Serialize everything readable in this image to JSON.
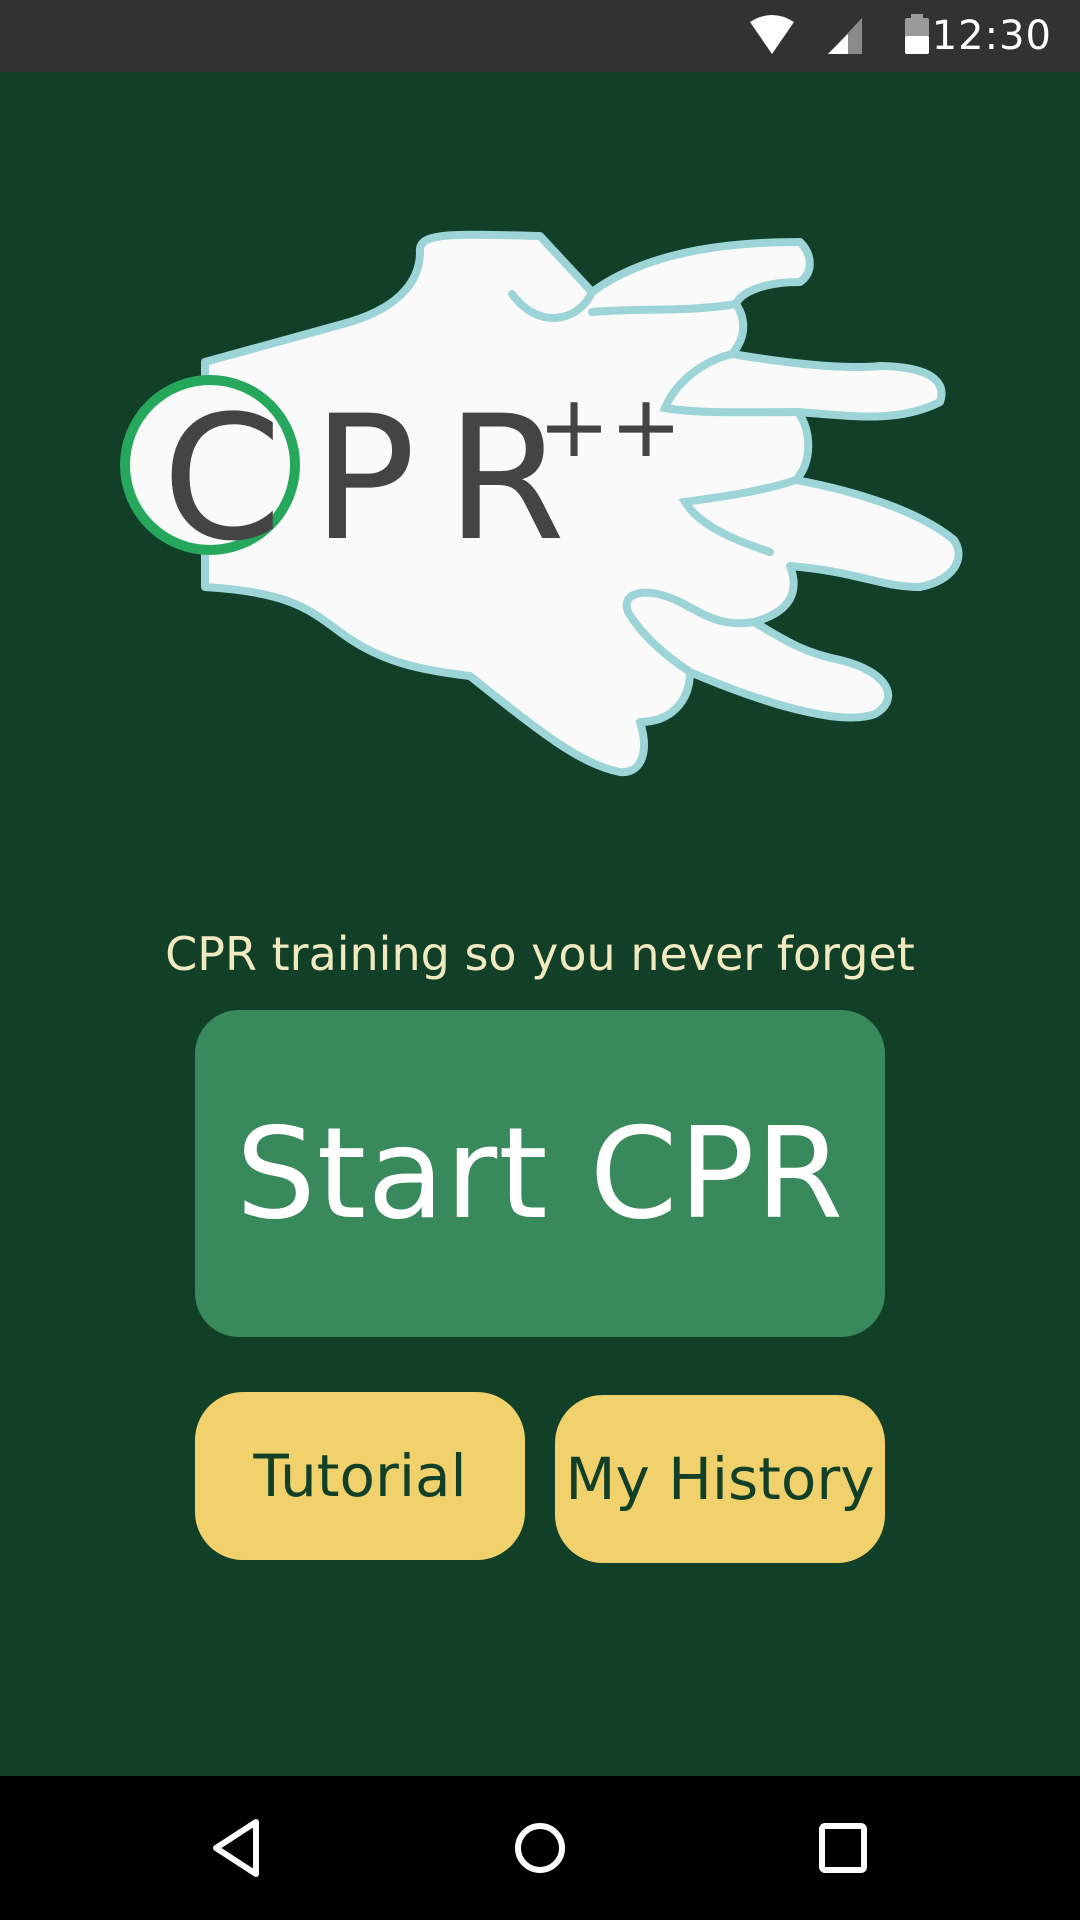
{
  "status_bar": {
    "time": "12:30",
    "icons": [
      "wifi-icon",
      "signal-icon",
      "battery-icon"
    ]
  },
  "logo": {
    "text": "CPR",
    "superscript": "++",
    "image": "hand-outline"
  },
  "tagline": "CPR training so you never forget",
  "buttons": {
    "start": "Start CPR",
    "tutorial": "Tutorial",
    "history": "My History"
  },
  "nav_bar": {
    "icons": [
      "back-icon",
      "home-icon",
      "recents-icon"
    ]
  },
  "colors": {
    "background": "#123f27",
    "status_bar": "#323232",
    "start_button": "#388a5d",
    "secondary_button": "#f0d16b",
    "tagline": "#f1e9bf",
    "hand_outline": "#9dd4d8",
    "logo_ring": "#25a85c"
  }
}
